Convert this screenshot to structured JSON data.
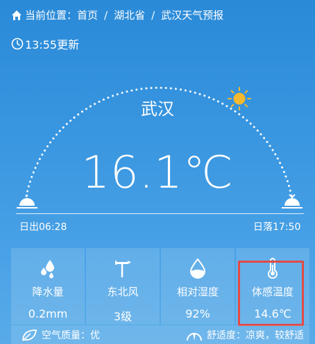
{
  "breadcrumb": {
    "prefix": "当前位置：",
    "items": [
      "首页",
      "湖北省",
      "武汉天气预报"
    ],
    "separator": "/"
  },
  "update_time": "13:55更新",
  "city": "武汉",
  "temperature": "16.1℃",
  "sunrise": "日出06:28",
  "sunset": "日落17:50",
  "cards": [
    {
      "icon": "rain-drops-icon",
      "label": "降水量",
      "value": "0.2mm"
    },
    {
      "icon": "wind-vane-icon",
      "label": "东北风",
      "value": "3级"
    },
    {
      "icon": "humidity-drop-icon",
      "label": "相对湿度",
      "value": "92%"
    },
    {
      "icon": "thermometer-icon",
      "label": "体感温度",
      "value": "14.6℃"
    }
  ],
  "air_quality": {
    "label": "空气质量：",
    "value": "优"
  },
  "comfort": {
    "label": "舒适度：",
    "value": "凉爽，较舒适"
  },
  "colors": {
    "highlight": "#e24a45",
    "sun": "#f5b82e",
    "background": "#3996e0"
  }
}
